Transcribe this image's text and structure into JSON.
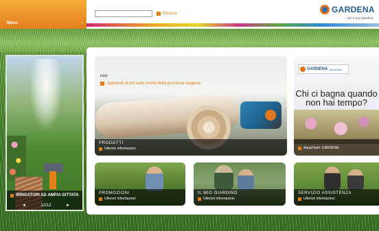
{
  "header": {
    "menu_label": "Menu",
    "menu_arrow": "›",
    "search_placeholder": "",
    "search_button_icon": "›",
    "search_button_label": "Ricerca",
    "logo_text": "GARDENA",
    "logo_tagline": "... vivi il tuo giardino"
  },
  "left_feature": {
    "title": "IRRIGATORI AD AMPIA GITTATA",
    "pager": "12/12",
    "prev_icon": "◄",
    "next_icon": "►"
  },
  "tiles": {
    "products": {
      "language": "Italia",
      "promo_text": "Apprendi di più sulle novità della prossima stagione",
      "title": "PRODOTTI",
      "link": "Ulteriori informazioni"
    },
    "aquaflash": {
      "brand": "GARDENA",
      "brand_sub": "AquaFlash",
      "headline": "Chi ci bagna quando non hai tempo?",
      "link": "AquaFlash: GARDENA"
    },
    "promotions": {
      "title": "PROMOZIONI",
      "link": "Ulteriori informazioni"
    },
    "my_garden": {
      "title": "IL MIO GIARDINO",
      "link": "Ulteriori informazioni"
    },
    "service": {
      "title": "SERVIZIO ASSISTENZA",
      "link": "Ulteriori informazioni"
    }
  },
  "colors": {
    "accent_orange": "#e47e14",
    "brand_blue": "#1f5a8f",
    "grass_green": "#4f8a35"
  }
}
